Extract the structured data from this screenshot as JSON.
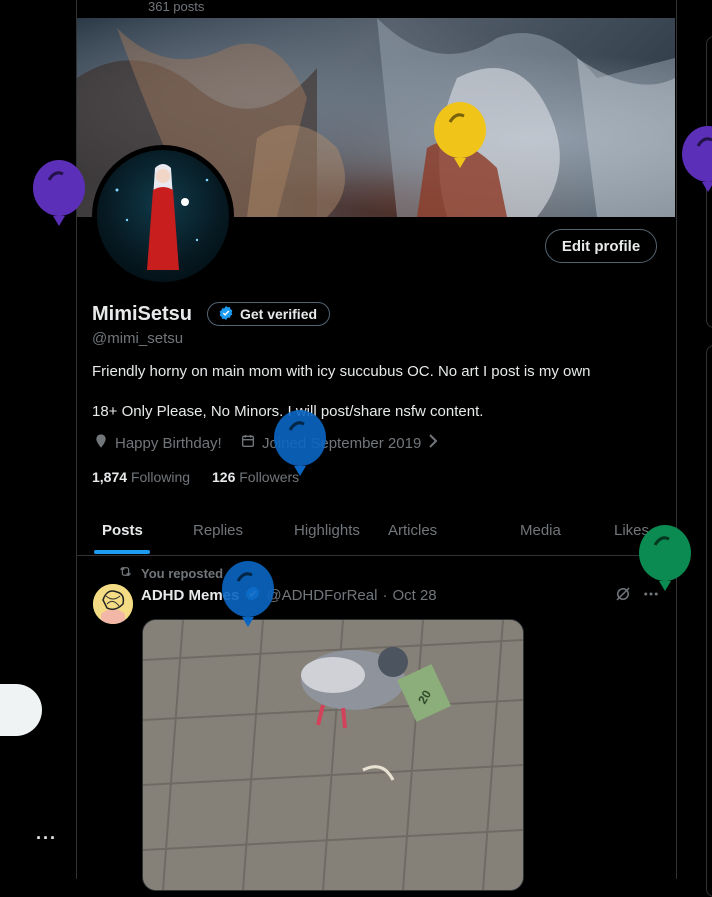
{
  "header": {
    "posts_count": "361 posts"
  },
  "profile": {
    "display_name": "MimiSetsu",
    "verify_label": "Get verified",
    "handle": "@mimi_setsu",
    "edit_label": "Edit profile",
    "bio_line1": "Friendly horny on main mom with icy succubus OC. No art I post is my own",
    "bio_line2": "18+ Only Please, No Minors. I will post/share nsfw content.",
    "birthday": "Happy Birthday!",
    "joined": "Joined September 2019",
    "following_count": "1,874",
    "following_label": "Following",
    "followers_count": "126",
    "followers_label": "Followers"
  },
  "tabs": [
    "Posts",
    "Replies",
    "Highlights",
    "Articles",
    "Media",
    "Likes"
  ],
  "post": {
    "repost_label": "You reposted",
    "author_name": "ADHD Memes",
    "author_handle": "@ADHDForReal",
    "separator": "·",
    "date": "Oct 28",
    "media_caption": "20"
  },
  "nav": {
    "more_label": "···"
  },
  "colors": {
    "accent": "#1d9bf0",
    "muted_text": "#71767b",
    "border": "#2f3336",
    "balloon_purple": "#5b2fb8",
    "balloon_yellow": "#f0c419",
    "balloon_blue": "#0a66c2",
    "balloon_green": "#0b8a52"
  },
  "icons": {
    "verified": "verified-badge-icon",
    "balloon": "balloon-icon",
    "calendar": "calendar-icon",
    "location": "location-pin-icon",
    "repost": "repost-icon",
    "grok": "grok-icon",
    "more": "more-icon"
  }
}
